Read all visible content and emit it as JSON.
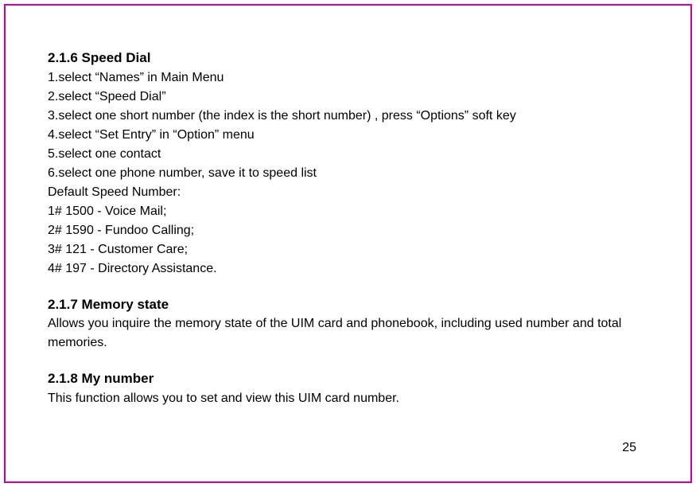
{
  "sections": {
    "speed_dial": {
      "heading": "2.1.6 Speed Dial",
      "line1": "1.select “Names” in Main Menu",
      "line2": "2.select “Speed Dial”",
      "line3": "3.select one short number (the index is the short number) , press “Options” soft key",
      "line4": "4.select “Set Entry” in “Option” menu",
      "line5": "5.select one contact",
      "line6": "6.select one phone number,  save it to speed list",
      "default_label": "Default Speed Number:",
      "default1": "1# 1500 - Voice Mail;",
      "default2": "2# 1590 - Fundoo Calling;",
      "default3": "3# 121 - Customer Care;",
      "default4": "4# 197 -  Directory Assistance."
    },
    "memory_state": {
      "heading": "2.1.7 Memory state",
      "body": "Allows you inquire the memory state of the UIM card and phonebook, including used number and total memories."
    },
    "my_number": {
      "heading": "2.1.8 My number",
      "body": "This function allows you to set and view this UIM card number."
    }
  },
  "page_number": "25"
}
